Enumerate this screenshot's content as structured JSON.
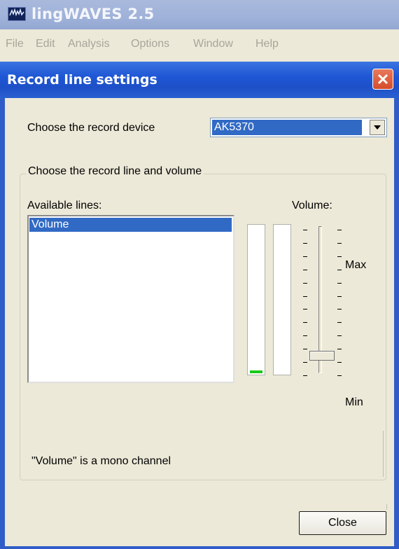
{
  "app": {
    "title": "lingWAVES 2.5",
    "menu": [
      "File",
      "Edit",
      "Analysis",
      "Options",
      "Window",
      "Help"
    ]
  },
  "dialog": {
    "title": "Record line settings",
    "device_label": "Choose the record device",
    "device_value": "AK5370",
    "group_title": "Choose the record line and volume",
    "lines_label": "Available lines:",
    "lines": [
      "Volume"
    ],
    "volume_label": "Volume:",
    "max_label": "Max",
    "min_label": "Min",
    "volume_level": 0.05,
    "meter_left_level": 0.02,
    "meter_right_level": 0,
    "status_text": "\"Volume\" is a mono channel",
    "close_label": "Close"
  },
  "colors": {
    "titlebar_blue": "#1f57d6",
    "selection": "#316ac5",
    "meter_green": "#17c917",
    "close_red": "#d54c2a"
  }
}
